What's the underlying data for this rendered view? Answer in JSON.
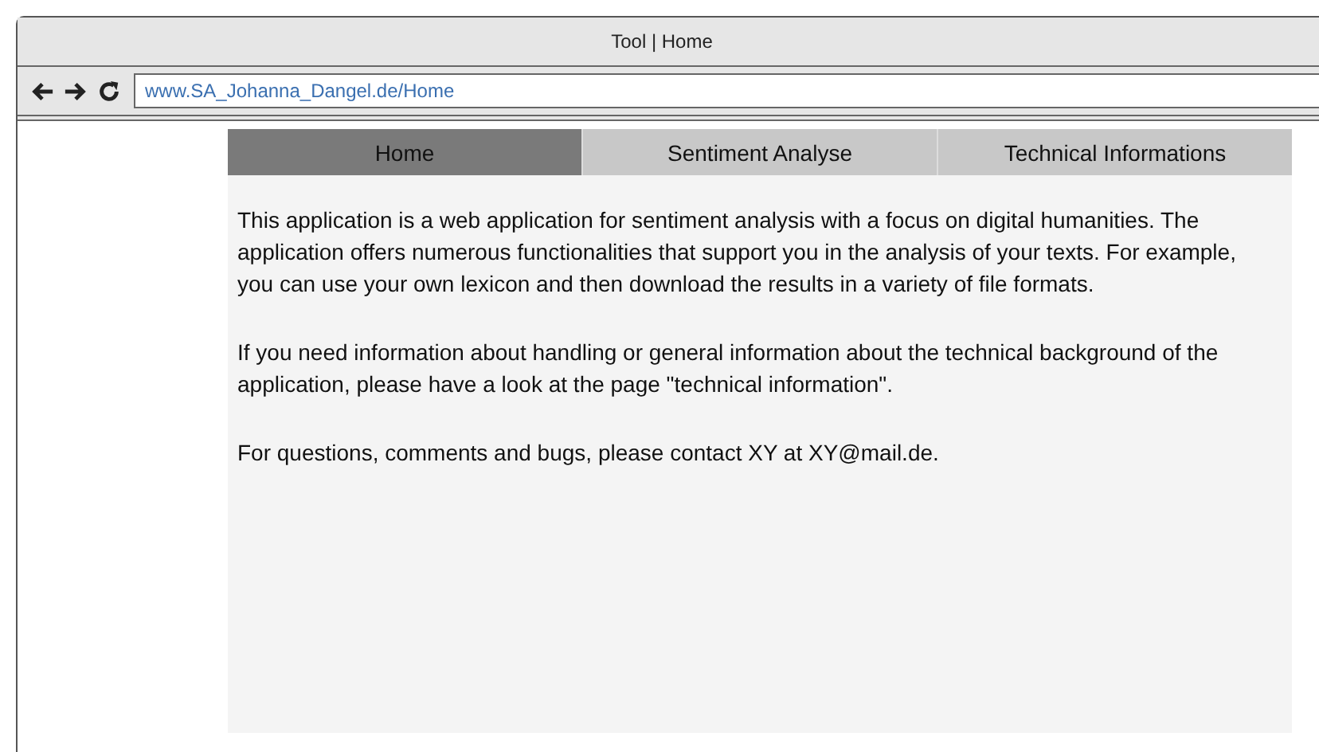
{
  "window": {
    "title": "Tool | Home"
  },
  "address_bar": {
    "url": "www.SA_Johanna_Dangel.de/Home"
  },
  "tabs": [
    {
      "label": "Home",
      "selected": true
    },
    {
      "label": "Sentiment Analyse",
      "selected": false
    },
    {
      "label": "Technical Informations",
      "selected": false
    }
  ],
  "paragraphs": [
    "This application is a web application for sentiment analysis with a focus on digital humanities. The application offers numerous functionalities that support you in the analysis of your texts. For example, you can use your own lexicon and then download the results in a variety of file formats.",
    "If you need information about handling or general information about the technical background of the application, please have a look at the page \"technical information\".",
    "For questions, comments and bugs, please contact XY at XY@mail.de."
  ]
}
